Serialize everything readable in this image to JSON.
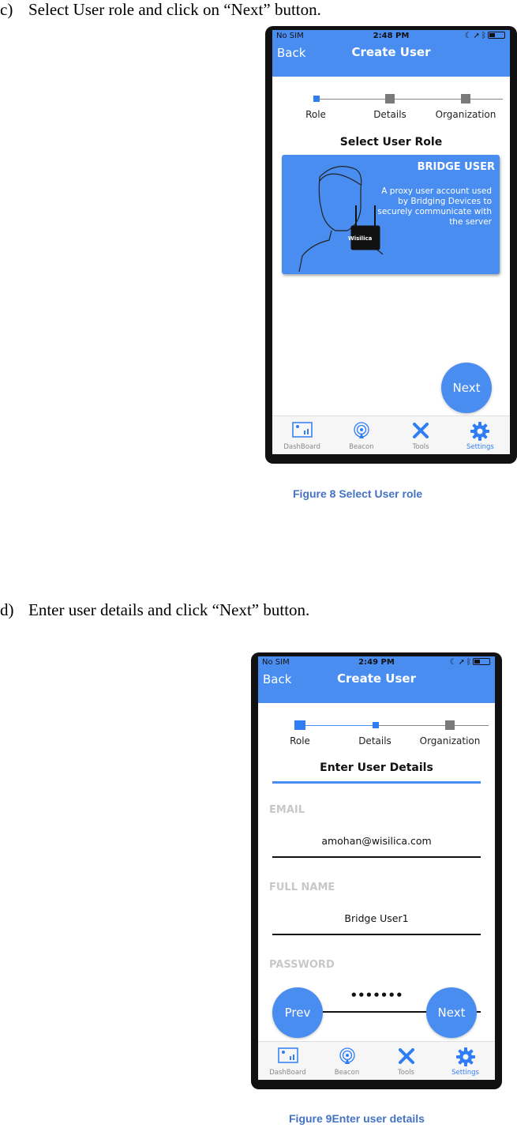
{
  "step_c": {
    "marker": "c)",
    "text": "Select User role and click on “Next” button."
  },
  "step_d": {
    "marker": "d)",
    "text": "Enter user details and click “Next” button."
  },
  "figure8": {
    "caption": "Figure 8 Select User role",
    "status": {
      "carrier": "No SIM",
      "time": "2:48 PM"
    },
    "header": {
      "back": "Back",
      "title": "Create User"
    },
    "steps": [
      "Role",
      "Details",
      "Organization"
    ],
    "section_title": "Select User Role",
    "card": {
      "title": "BRIDGE USER",
      "description": "A proxy user account used by Bridging Devices to securely communicate with the server",
      "device_label": "Wisilica"
    },
    "next_button": "Next",
    "tabs": [
      "DashBoard",
      "Beacon",
      "Tools",
      "Settings"
    ],
    "active_tab": "Settings"
  },
  "figure9": {
    "caption": "Figure 9Enter user details",
    "status": {
      "carrier": "No SIM",
      "time": "2:49 PM"
    },
    "header": {
      "back": "Back",
      "title": "Create User"
    },
    "steps": [
      "Role",
      "Details",
      "Organization"
    ],
    "section_title": "Enter User Details",
    "form": {
      "email_label": "EMAIL",
      "email_value": "amohan@wisilica.com",
      "fullname_label": "FULL NAME",
      "fullname_value": "Bridge User1",
      "password_label": "PASSWORD",
      "password_value": "•••••••"
    },
    "prev_button": "Prev",
    "next_button": "Next",
    "tabs": [
      "DashBoard",
      "Beacon",
      "Tools",
      "Settings"
    ],
    "active_tab": "Settings"
  },
  "colors": {
    "accent": "#4a8df0",
    "caption": "#4472c4",
    "active_tab": "#2f7ef5"
  }
}
